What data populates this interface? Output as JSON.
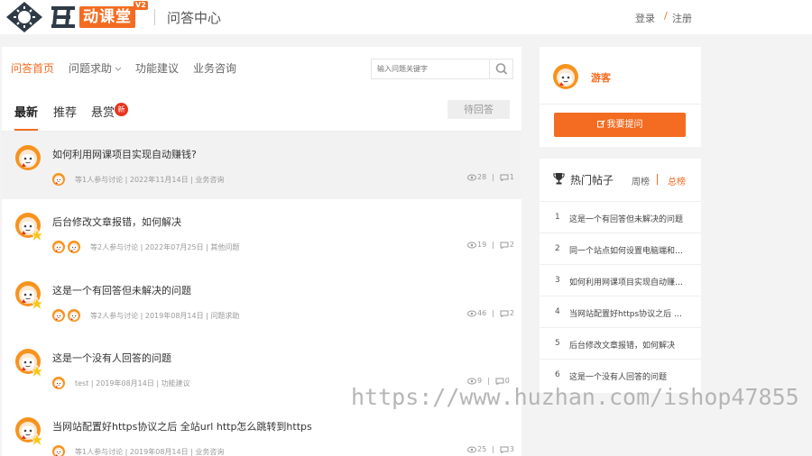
{
  "colors": {
    "accent": "#f36c21",
    "page_bg": "#f3f3f3",
    "badge_red": "#e8341c"
  },
  "header": {
    "logo_text": "动课堂",
    "logo_version": "V2",
    "site_title": "问答中心",
    "login_label": "登录",
    "separator": "/",
    "register_label": "注册"
  },
  "nav": {
    "items": [
      {
        "label": "问答首页"
      },
      {
        "label": "问题求助"
      },
      {
        "label": "功能建议"
      },
      {
        "label": "业务咨询"
      }
    ],
    "search_placeholder": "输入问题关键字",
    "search_icon": "search-icon"
  },
  "tabs": {
    "items": [
      {
        "label": "最新"
      },
      {
        "label": "推荐"
      },
      {
        "label": "悬赏"
      }
    ],
    "hot_badge": "新",
    "wait_button": "待回答"
  },
  "questions": [
    {
      "title": "如何利用网课项目实现自动赚钱?",
      "meta": "等1人参与讨论 | 2022年11月14日 | 业务咨询",
      "views": "28",
      "answers": "1"
    },
    {
      "title": "后台修改文章报错，如何解决",
      "meta": "等2人参与讨论 | 2022年07月25日 | 其他问题",
      "views": "19",
      "answers": "2"
    },
    {
      "title": "这是一个有回答但未解决的问题",
      "meta": "等2人参与讨论 | 2019年08月14日 | 问题求助",
      "views": "46",
      "answers": "2"
    },
    {
      "title": "这是一个没有人回答的问题",
      "meta": "test | 2019年08月14日 | 功能建议",
      "views": "9",
      "answers": "0"
    },
    {
      "title": "当网站配置好https协议之后 全站url http怎么跳转到https",
      "meta": "等1人参与讨论 | 2019年08月14日 | 业务咨询",
      "views": "25",
      "answers": "3"
    }
  ],
  "stats_separator": "|",
  "user": {
    "name": "游客",
    "ask_button": "我要提问"
  },
  "hot": {
    "title": "热门帖子",
    "week_label": "周榜",
    "total_label": "总榜",
    "items": [
      {
        "num": "1",
        "text": "这是一个有回答但未解决的问题"
      },
      {
        "num": "2",
        "text": "同一个站点如何设置电脑端和手机端"
      },
      {
        "num": "3",
        "text": "如何利用网课项目实现自动赚钱?"
      },
      {
        "num": "4",
        "text": "当网站配置好https协议之后 全站url http怎么跳转到https"
      },
      {
        "num": "5",
        "text": "后台修改文章报错，如何解决"
      },
      {
        "num": "6",
        "text": "这是一个没有人回答的问题"
      }
    ]
  },
  "watermark": "https://www.huzhan.com/ishop47855"
}
